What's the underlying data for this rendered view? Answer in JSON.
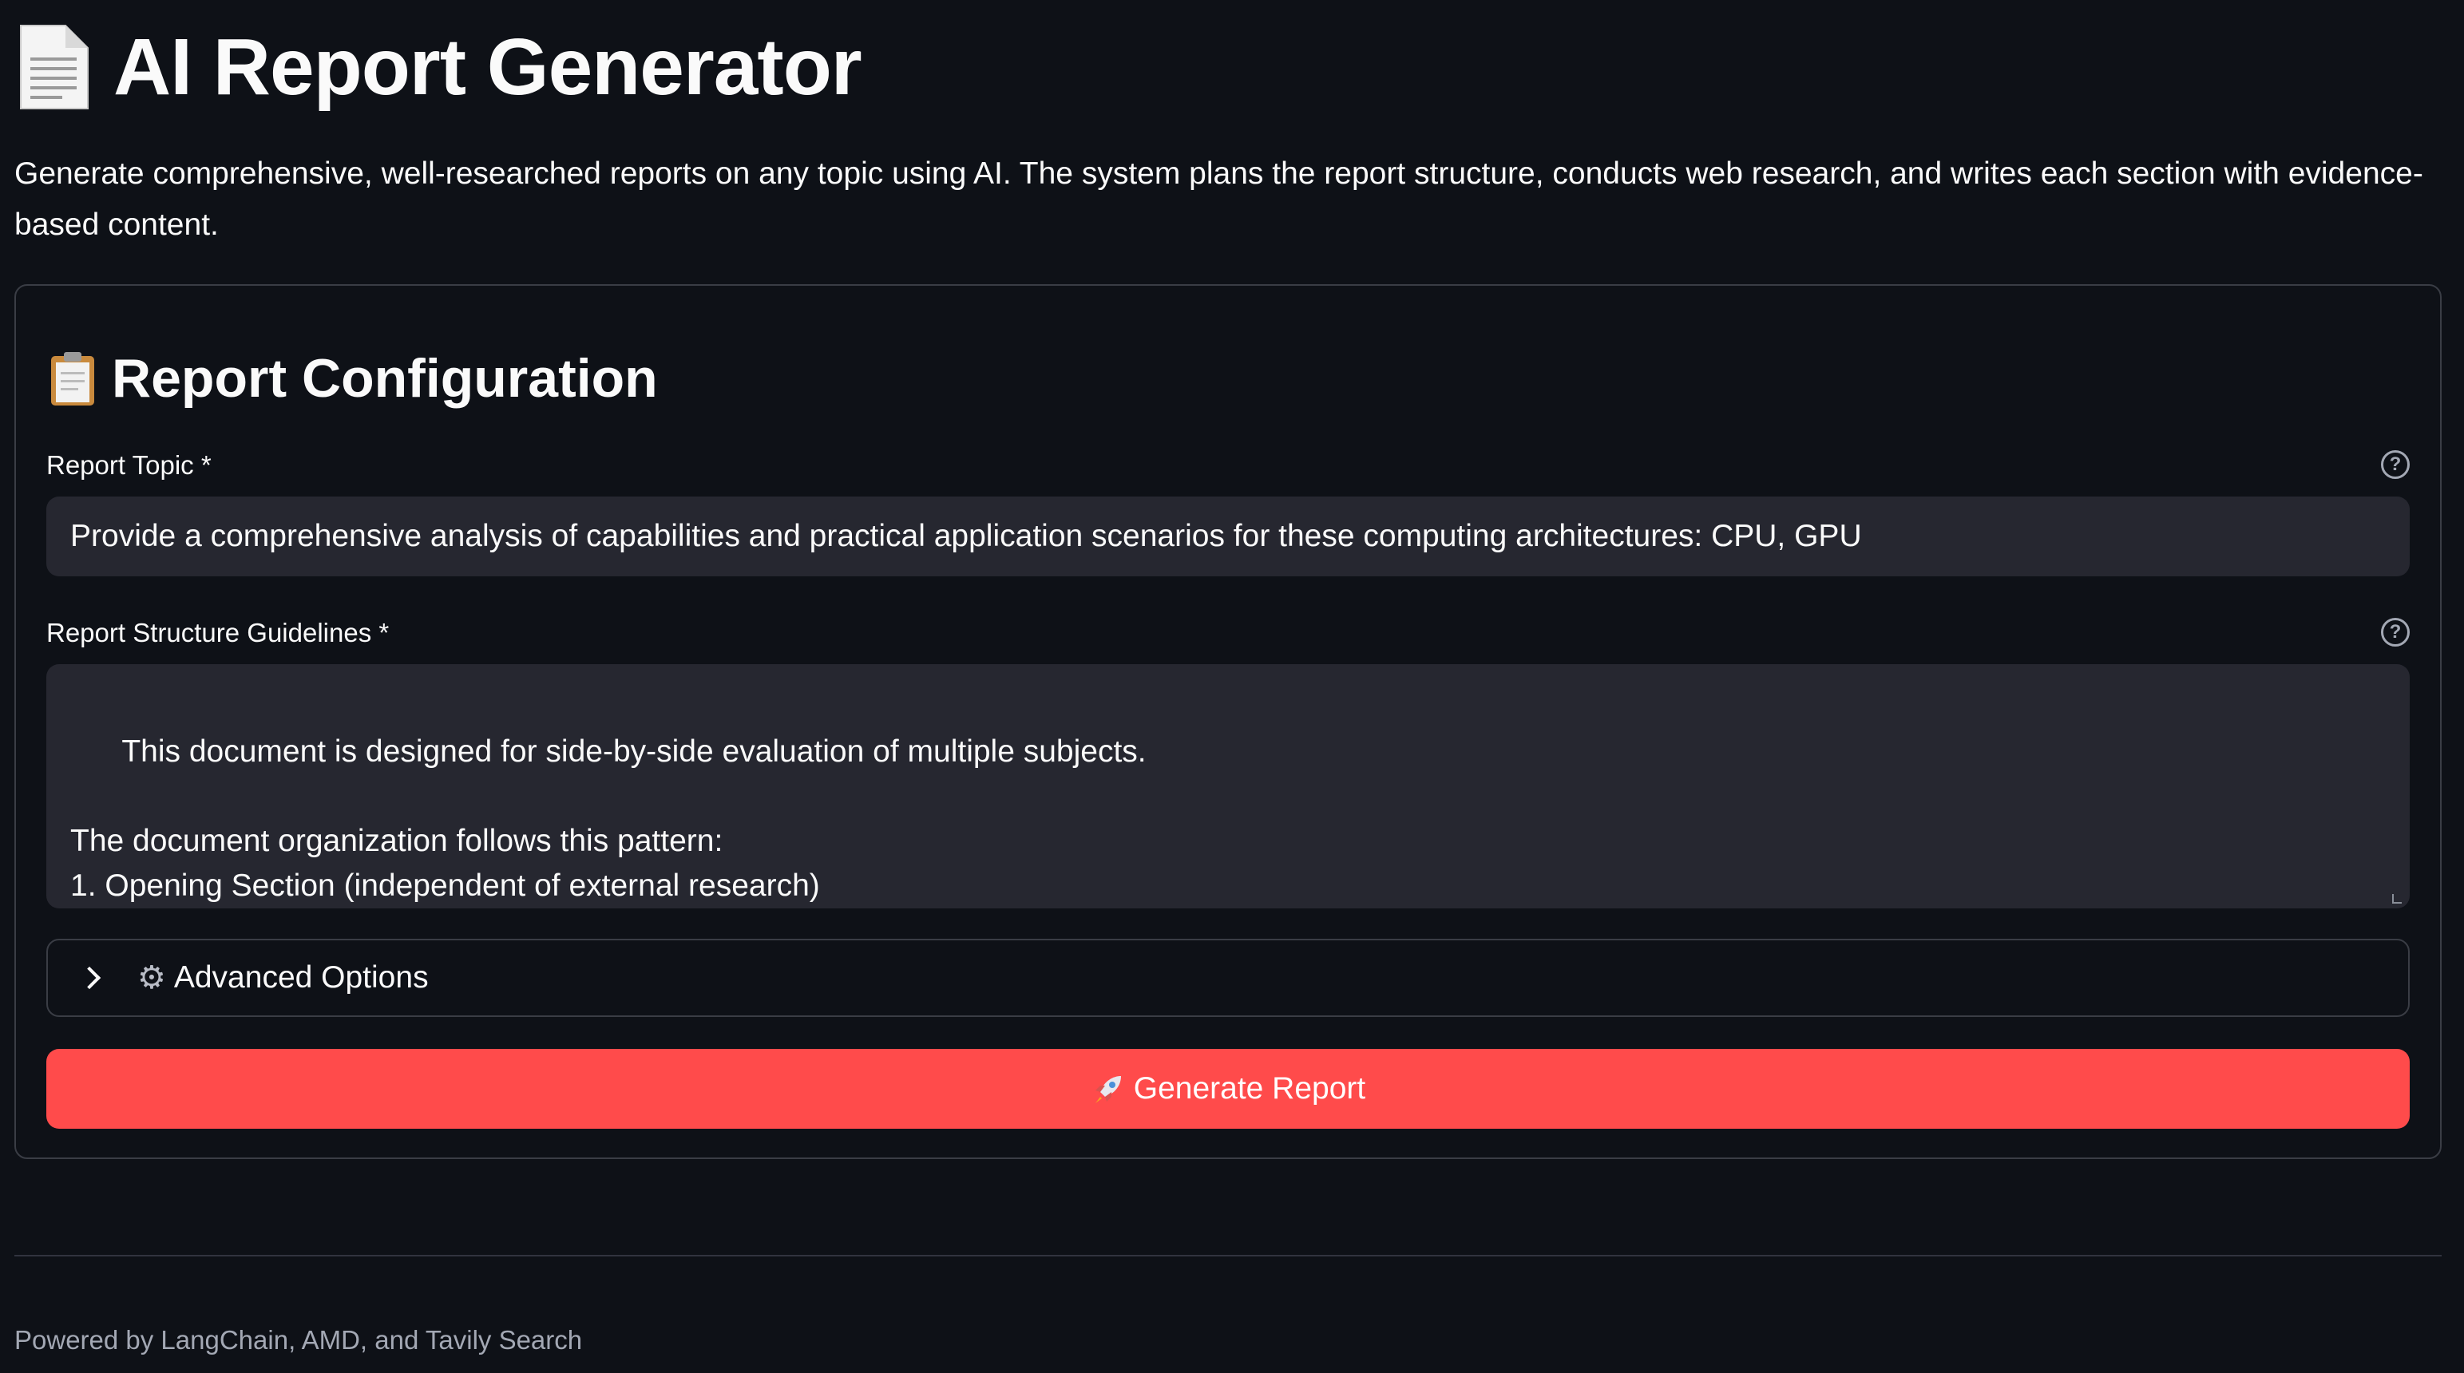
{
  "header": {
    "title": "AI Report Generator",
    "title_icon": "page-document-icon",
    "description": "Generate comprehensive, well-researched reports on any topic using AI. The system plans the report structure, conducts web research, and writes each section with evidence-based content."
  },
  "config": {
    "section_title": "Report Configuration",
    "section_icon": "clipboard-icon",
    "topic": {
      "label": "Report Topic *",
      "value": "Provide a comprehensive analysis of capabilities and practical application scenarios for these computing architectures: CPU, GPU",
      "help_icon": "question-circle-icon"
    },
    "guidelines": {
      "label": "Report Structure Guidelines *",
      "value": "This document is designed for side-by-side evaluation of multiple subjects.\n\nThe document organization follows this pattern:\n1. Opening Section (independent of external research)\n  - High-level summary of the subject matter",
      "help_icon": "question-circle-icon"
    },
    "advanced": {
      "label": "Advanced Options",
      "icon": "gear-icon"
    },
    "generate": {
      "label": "Generate Report",
      "icon": "rocket-icon"
    }
  },
  "footer": {
    "text": "Powered by LangChain, AMD, and Tavily Search"
  },
  "colors": {
    "background": "#0e1117",
    "input_background": "#262730",
    "primary_button": "#ff4b4b",
    "border": "#3a3d45",
    "muted_text": "#a3a8b4"
  }
}
